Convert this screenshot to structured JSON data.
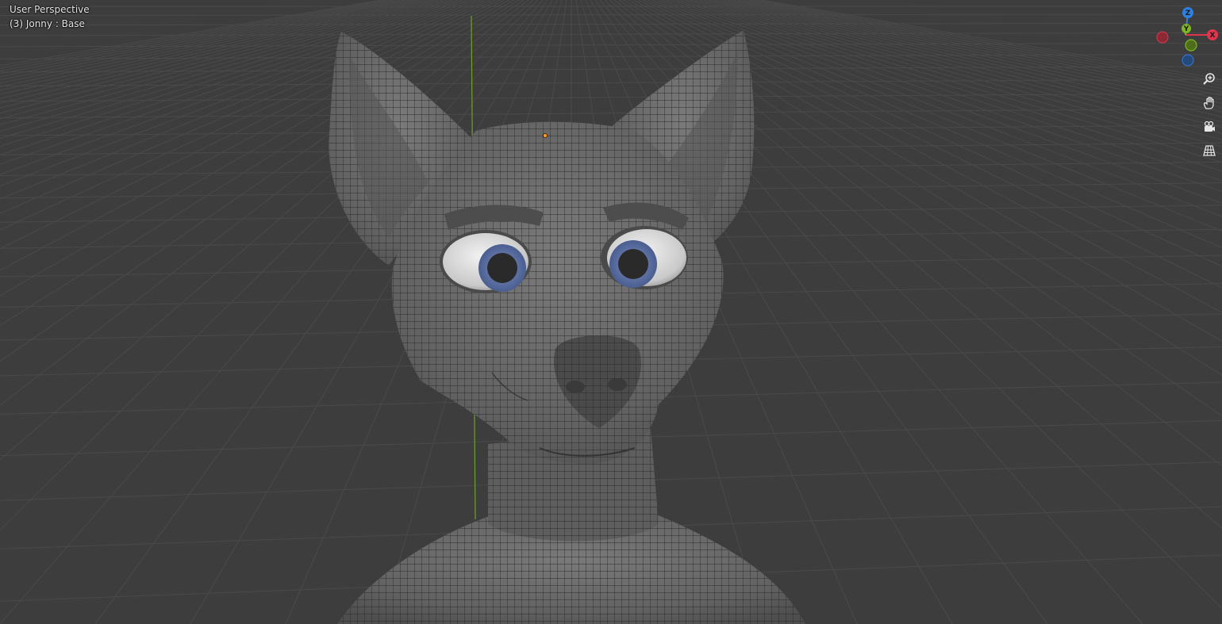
{
  "viewport": {
    "view_name": "User Perspective",
    "object_info": "(3) Jonny : Base"
  },
  "gizmo": {
    "axes": [
      {
        "label": "Z",
        "color": "#2f7fe0"
      },
      {
        "label": "Y",
        "color": "#7cb526"
      },
      {
        "label": "X",
        "color": "#e0354d"
      }
    ]
  },
  "nav_tools": [
    {
      "icon": "zoom-icon"
    },
    {
      "icon": "pan-hand-icon"
    },
    {
      "icon": "camera-icon"
    },
    {
      "icon": "perspective-grid-icon"
    }
  ],
  "colors": {
    "background": "#3d3d3d",
    "grid_line": "#4a4a4a",
    "mesh_fill": "#6a6a6a",
    "mesh_wire": "#2a2a2a",
    "y_axis_line": "#6fa02a",
    "iris": "#5a6e9e",
    "origin_dot": "#ff9a1a"
  }
}
